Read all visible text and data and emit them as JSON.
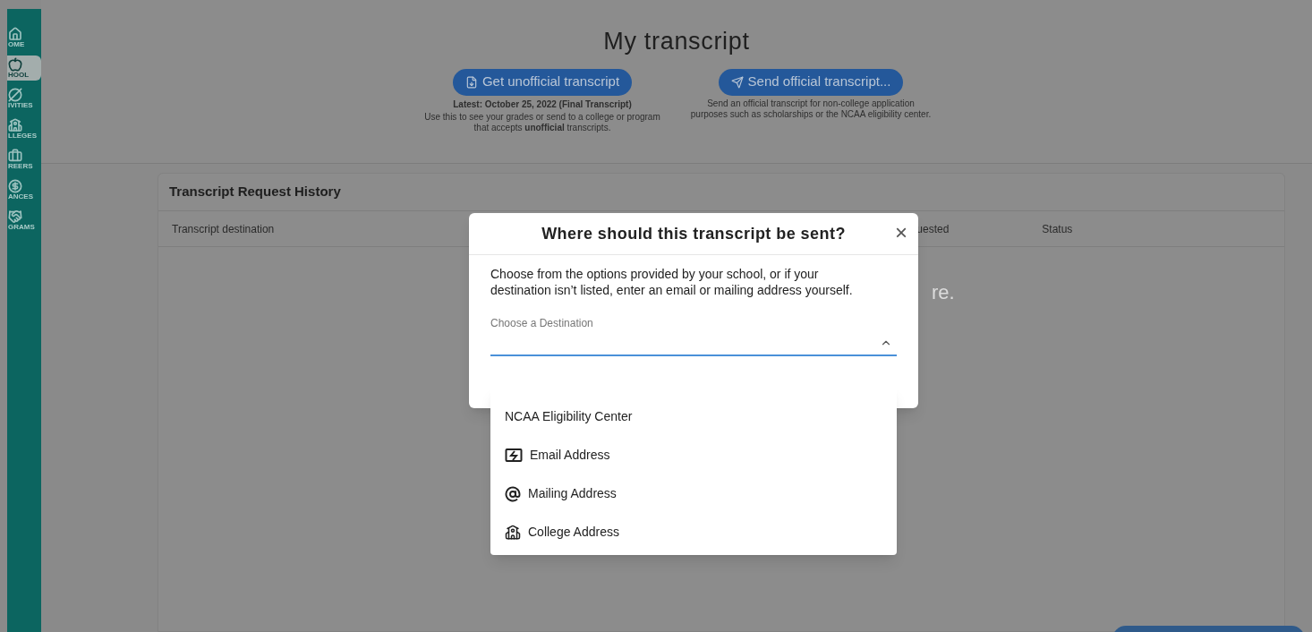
{
  "sidebar": {
    "items": [
      {
        "label": "OME",
        "selected": false
      },
      {
        "label": "HOOL",
        "selected": true
      },
      {
        "label": "IVITIES",
        "selected": false
      },
      {
        "label": "LLEGES",
        "selected": false
      },
      {
        "label": "REERS",
        "selected": false
      },
      {
        "label": "ANCES",
        "selected": false
      },
      {
        "label": "GRAMS",
        "selected": false
      }
    ]
  },
  "header": {
    "title": "My transcript",
    "actions": [
      {
        "button": "Get unofficial transcript",
        "lines": [
          "Latest: October 25, 2022 (Final Transcript)",
          "Use this to see your grades or send to a college or program that accepts **unofficial** transcripts."
        ]
      },
      {
        "button": "Send official transcript...",
        "lines": [
          "Send an official transcript for non-college application purposes such as scholarships or the NCAA eligibility center."
        ]
      }
    ]
  },
  "history": {
    "title": "Transcript Request History",
    "columns": [
      "Transcript destination",
      "uested",
      "Status"
    ],
    "empty_message": "re."
  },
  "dialog": {
    "title": "Where should this transcript be sent?",
    "close": "×",
    "description": "Choose from the options provided by your school, or if your destination isn’t listed, enter an email or mailing address yourself.",
    "field": {
      "label": "Choose a Destination",
      "expanded": true
    },
    "options": [
      {
        "kind": "plain",
        "label": "NCAA Eligibility Center"
      },
      {
        "kind": "icon",
        "label": "Email Address"
      },
      {
        "kind": "icon",
        "label": "Mailing Address"
      },
      {
        "kind": "icon",
        "label": "College Address"
      }
    ]
  }
}
